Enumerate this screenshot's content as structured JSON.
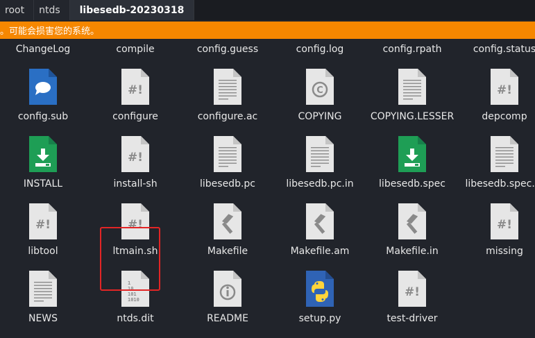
{
  "tabs": [
    {
      "label": "root"
    },
    {
      "label": "ntds"
    },
    {
      "label": "libesedb-20230318"
    }
  ],
  "warning": {
    "text": "。可能会损害您的系统。"
  },
  "top_row": [
    "ChangeLog",
    "compile",
    "config.guess",
    "config.log",
    "config.rpath",
    "config.status"
  ],
  "files": [
    {
      "name": "config.sub",
      "icon": "chat-bubble-icon"
    },
    {
      "name": "configure",
      "icon": "script-icon"
    },
    {
      "name": "configure.ac",
      "icon": "text-icon"
    },
    {
      "name": "COPYING",
      "icon": "copyright-icon"
    },
    {
      "name": "COPYING.LESSER",
      "icon": "text-icon"
    },
    {
      "name": "depcomp",
      "icon": "script-icon"
    },
    {
      "name": "INSTALL",
      "icon": "install-icon"
    },
    {
      "name": "install-sh",
      "icon": "script-icon"
    },
    {
      "name": "libesedb.pc",
      "icon": "text-icon"
    },
    {
      "name": "libesedb.pc.in",
      "icon": "text-icon"
    },
    {
      "name": "libesedb.spec",
      "icon": "install-icon"
    },
    {
      "name": "libesedb.spec.in",
      "icon": "text-icon"
    },
    {
      "name": "libtool",
      "icon": "script-icon"
    },
    {
      "name": "ltmain.sh",
      "icon": "script-icon"
    },
    {
      "name": "Makefile",
      "icon": "hammer-icon"
    },
    {
      "name": "Makefile.am",
      "icon": "hammer-icon"
    },
    {
      "name": "Makefile.in",
      "icon": "hammer-icon"
    },
    {
      "name": "missing",
      "icon": "script-icon"
    },
    {
      "name": "NEWS",
      "icon": "text-icon"
    },
    {
      "name": "ntds.dit",
      "icon": "binary-icon"
    },
    {
      "name": "README",
      "icon": "info-icon"
    },
    {
      "name": "setup.py",
      "icon": "python-icon"
    },
    {
      "name": "test-driver",
      "icon": "script-icon"
    }
  ],
  "selected_file": "ntds.dit",
  "colors": {
    "background": "#21242b",
    "warning": "#f68700",
    "selection_border": "#e22525",
    "doc_page": "#e6e6e6",
    "doc_glyph": "#8a8a8a",
    "install_green": "#1e9e55",
    "chat_blue": "#2a6fc4",
    "python_blue": "#2f63b5"
  },
  "glyphs": {
    "script": "#!",
    "binary_lines": [
      "1",
      "10",
      "101",
      "1010"
    ]
  }
}
